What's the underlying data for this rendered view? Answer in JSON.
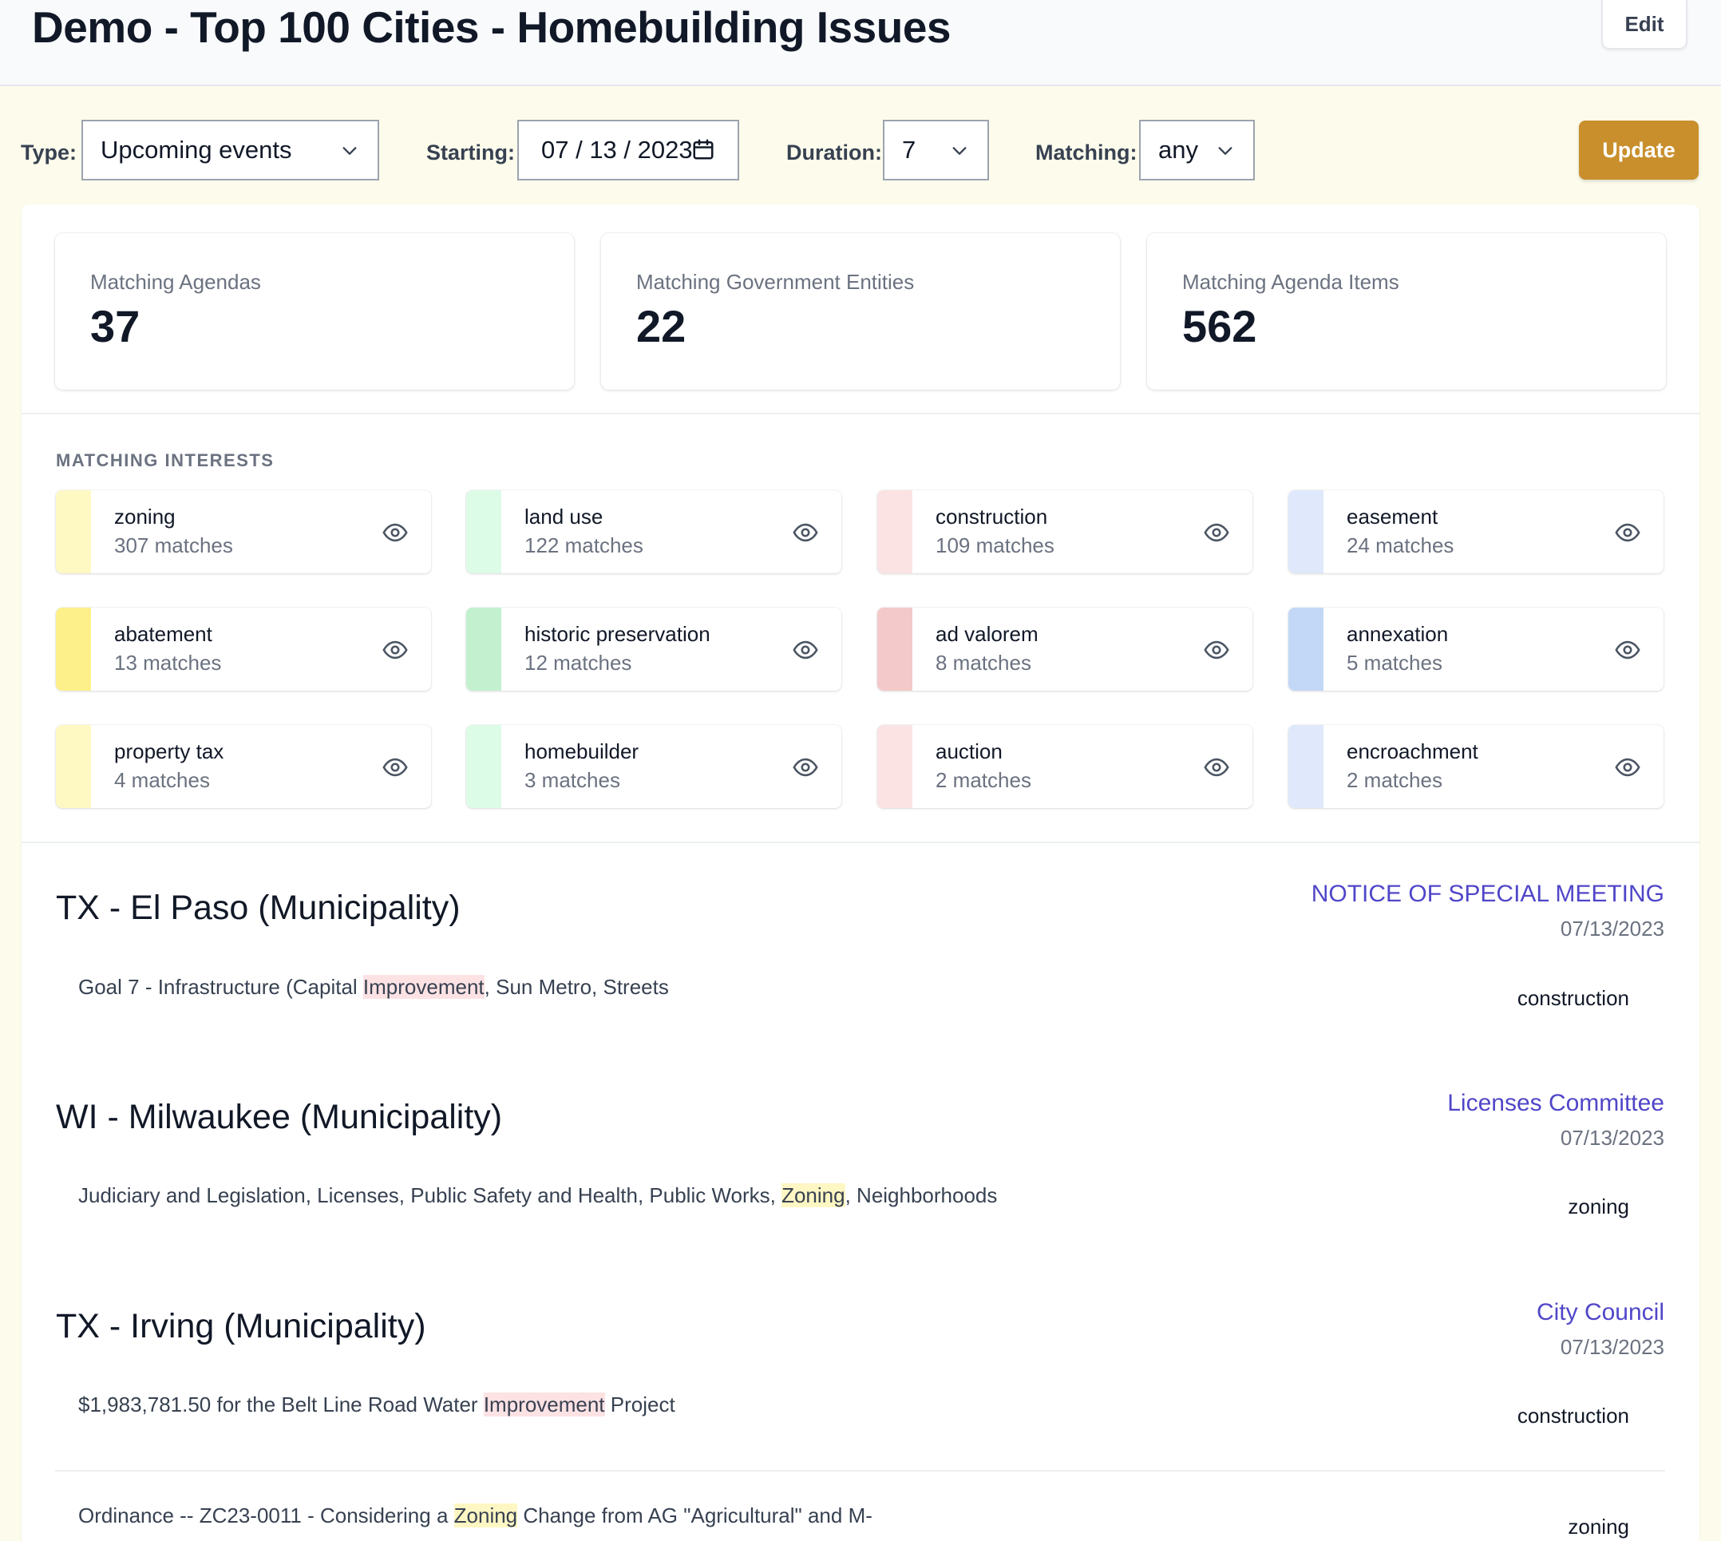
{
  "header": {
    "title": "Demo - Top 100 Cities - Homebuilding Issues",
    "edit_label": "Edit"
  },
  "filters": {
    "type_label": "Type:",
    "type_value": "Upcoming events",
    "starting_label": "Starting:",
    "starting_value": "07 / 13 / 2023",
    "duration_label": "Duration:",
    "duration_value": "7",
    "matching_label": "Matching:",
    "matching_value": "any",
    "update_label": "Update"
  },
  "stats": [
    {
      "label": "Matching Agendas",
      "value": "37"
    },
    {
      "label": "Matching Government Entities",
      "value": "22"
    },
    {
      "label": "Matching Agenda Items",
      "value": "562"
    }
  ],
  "interests_title": "MATCHING INTERESTS",
  "interests": [
    {
      "name": "zoning",
      "count": "307 matches",
      "color": "#fef9c3",
      "icon": "eye-icon"
    },
    {
      "name": "land use",
      "count": "122 matches",
      "color": "#dcfce7",
      "icon": "eye-icon"
    },
    {
      "name": "construction",
      "count": "109 matches",
      "color": "#fbe3e4",
      "icon": "eye-icon"
    },
    {
      "name": "easement",
      "count": "24 matches",
      "color": "#dfe9fb",
      "icon": "eye-icon"
    },
    {
      "name": "abatement",
      "count": "13 matches",
      "color": "#fdf08a",
      "icon": "eye-icon"
    },
    {
      "name": "historic preservation",
      "count": "12 matches",
      "color": "#c3f1cf",
      "icon": "eye-icon"
    },
    {
      "name": "ad valorem",
      "count": "8 matches",
      "color": "#f4c9c9",
      "icon": "eye-icon"
    },
    {
      "name": "annexation",
      "count": "5 matches",
      "color": "#c3d8f7",
      "icon": "eye-icon"
    },
    {
      "name": "property tax",
      "count": "4 matches",
      "color": "#fef9c3",
      "icon": "eye-icon"
    },
    {
      "name": "homebuilder",
      "count": "3 matches",
      "color": "#dcfce7",
      "icon": "eye-icon"
    },
    {
      "name": "auction",
      "count": "2 matches",
      "color": "#fbe3e4",
      "icon": "eye-icon"
    },
    {
      "name": "encroachment",
      "count": "2 matches",
      "color": "#dfe9fb",
      "icon": "eye-icon"
    }
  ],
  "results": [
    {
      "city": "TX - El Paso (Municipality)",
      "meeting": "NOTICE OF SPECIAL MEETING",
      "date": "07/13/2023",
      "items": [
        {
          "pre": "Goal 7 - Infrastructure (Capital ",
          "hl": "Improvement",
          "post": ", Sun Metro, Streets",
          "tag": "construction"
        }
      ]
    },
    {
      "city": "WI - Milwaukee (Municipality)",
      "meeting": "Licenses Committee",
      "date": "07/13/2023",
      "items": [
        {
          "pre": "Judiciary and Legislation, Licenses, Public Safety and Health, Public Works, ",
          "hl": "Zoning",
          "post": ", Neighborhoods",
          "tag": "zoning"
        }
      ]
    },
    {
      "city": "TX - Irving (Municipality)",
      "meeting": "City Council",
      "date": "07/13/2023",
      "items": [
        {
          "pre": "$1,983,781.50 for the Belt Line Road Water ",
          "hl": "Improvement",
          "post": " Project",
          "tag": "construction"
        },
        {
          "pre": "Ordinance -- ZC23-0011 - Considering a ",
          "hl": "Zoning",
          "post": " Change from AG \"Agricultural\" and M-",
          "tag": "zoning"
        }
      ]
    }
  ]
}
